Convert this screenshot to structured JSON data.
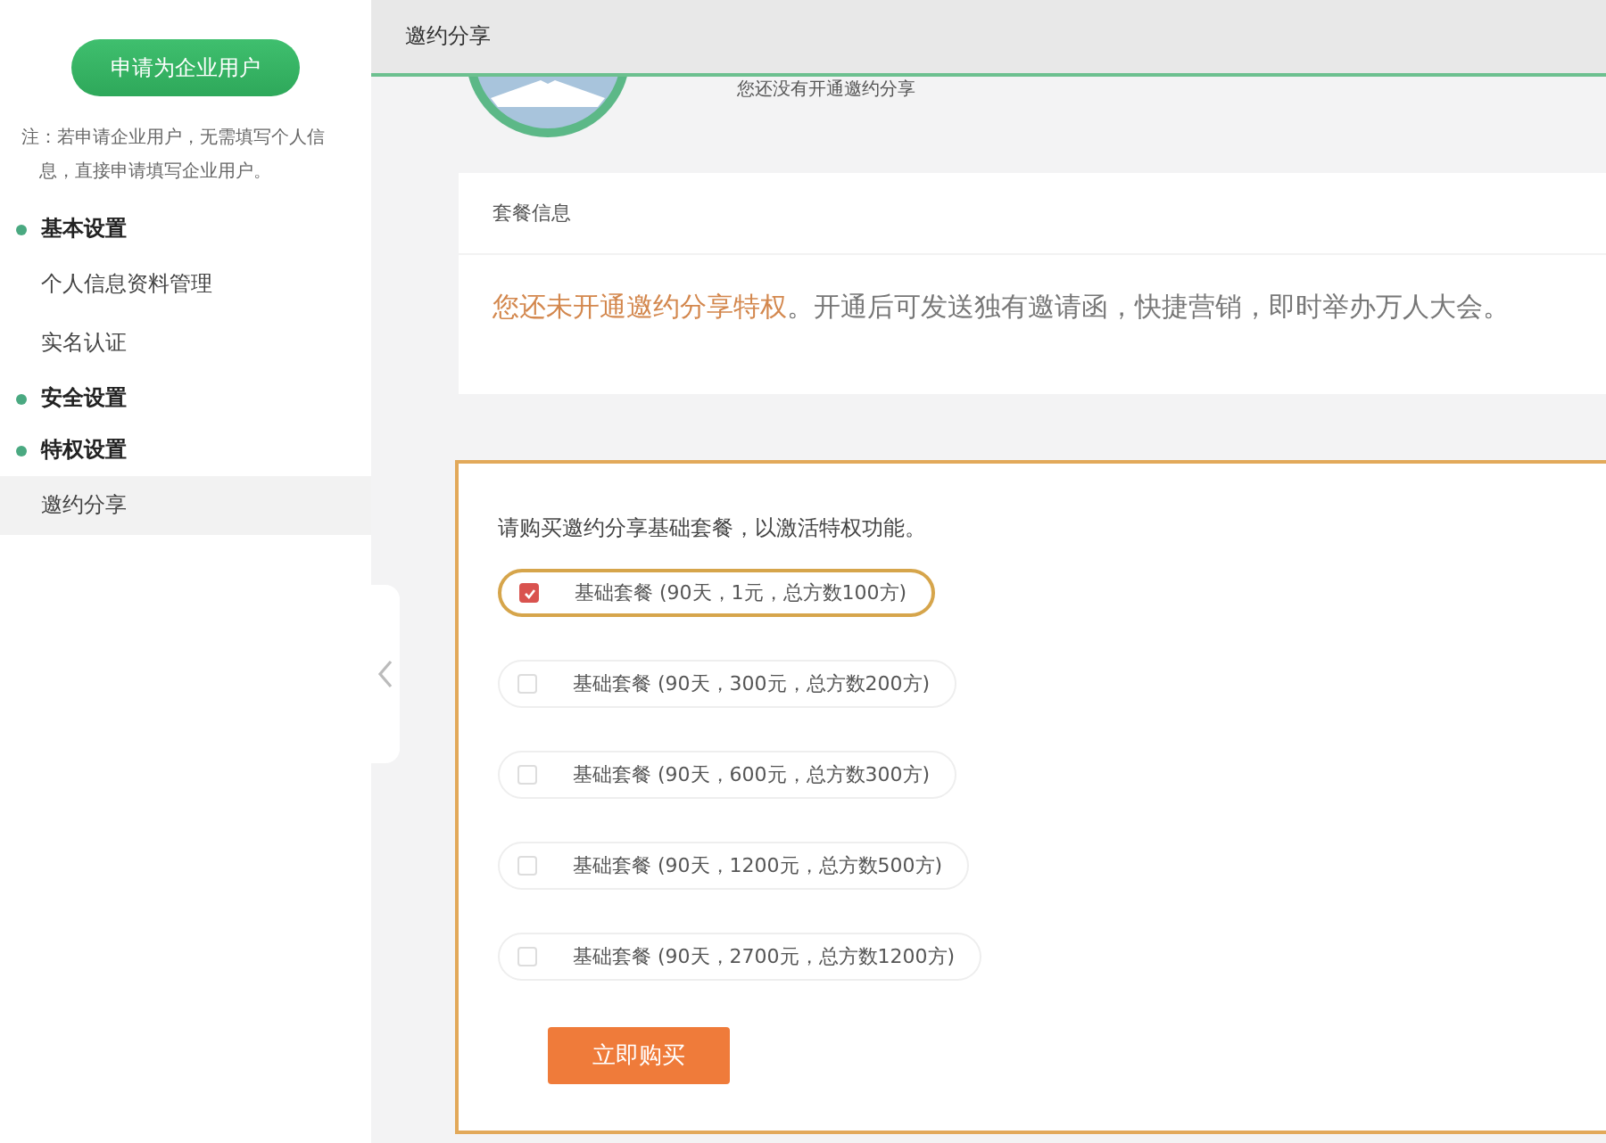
{
  "sidebar": {
    "apply_button": "申请为企业用户",
    "note": "注：若申请企业用户，无需填写个人信息，直接申请填写企业用户。",
    "sections": [
      {
        "title": "基本设置",
        "items": [
          {
            "label": "个人信息资料管理",
            "selected": false
          },
          {
            "label": "实名认证",
            "selected": false
          }
        ]
      },
      {
        "title": "安全设置"
      },
      {
        "title": "特权设置",
        "items": [
          {
            "label": "邀约分享",
            "selected": true
          }
        ]
      }
    ]
  },
  "header": {
    "title": "邀约分享"
  },
  "profile": {
    "status": "您还没有开通邀约分享"
  },
  "package_info": {
    "title": "套餐信息",
    "notice_highlight": "您还未开通邀约分享特权",
    "notice_rest": "。开通后可发送独有邀请函，快捷营销，即时举办万人大会。"
  },
  "purchase": {
    "prompt": "请购买邀约分享基础套餐，以激活特权功能。",
    "options": [
      {
        "label": "基础套餐 (90天，1元，总方数100方)",
        "selected": true
      },
      {
        "label": "基础套餐 (90天，300元，总方数200方)",
        "selected": false
      },
      {
        "label": "基础套餐 (90天，600元，总方数300方)",
        "selected": false
      },
      {
        "label": "基础套餐 (90天，1200元，总方数500方)",
        "selected": false
      },
      {
        "label": "基础套餐 (90天，2700元，总方数1200方)",
        "selected": false
      }
    ],
    "buy_button": "立即购买"
  }
}
